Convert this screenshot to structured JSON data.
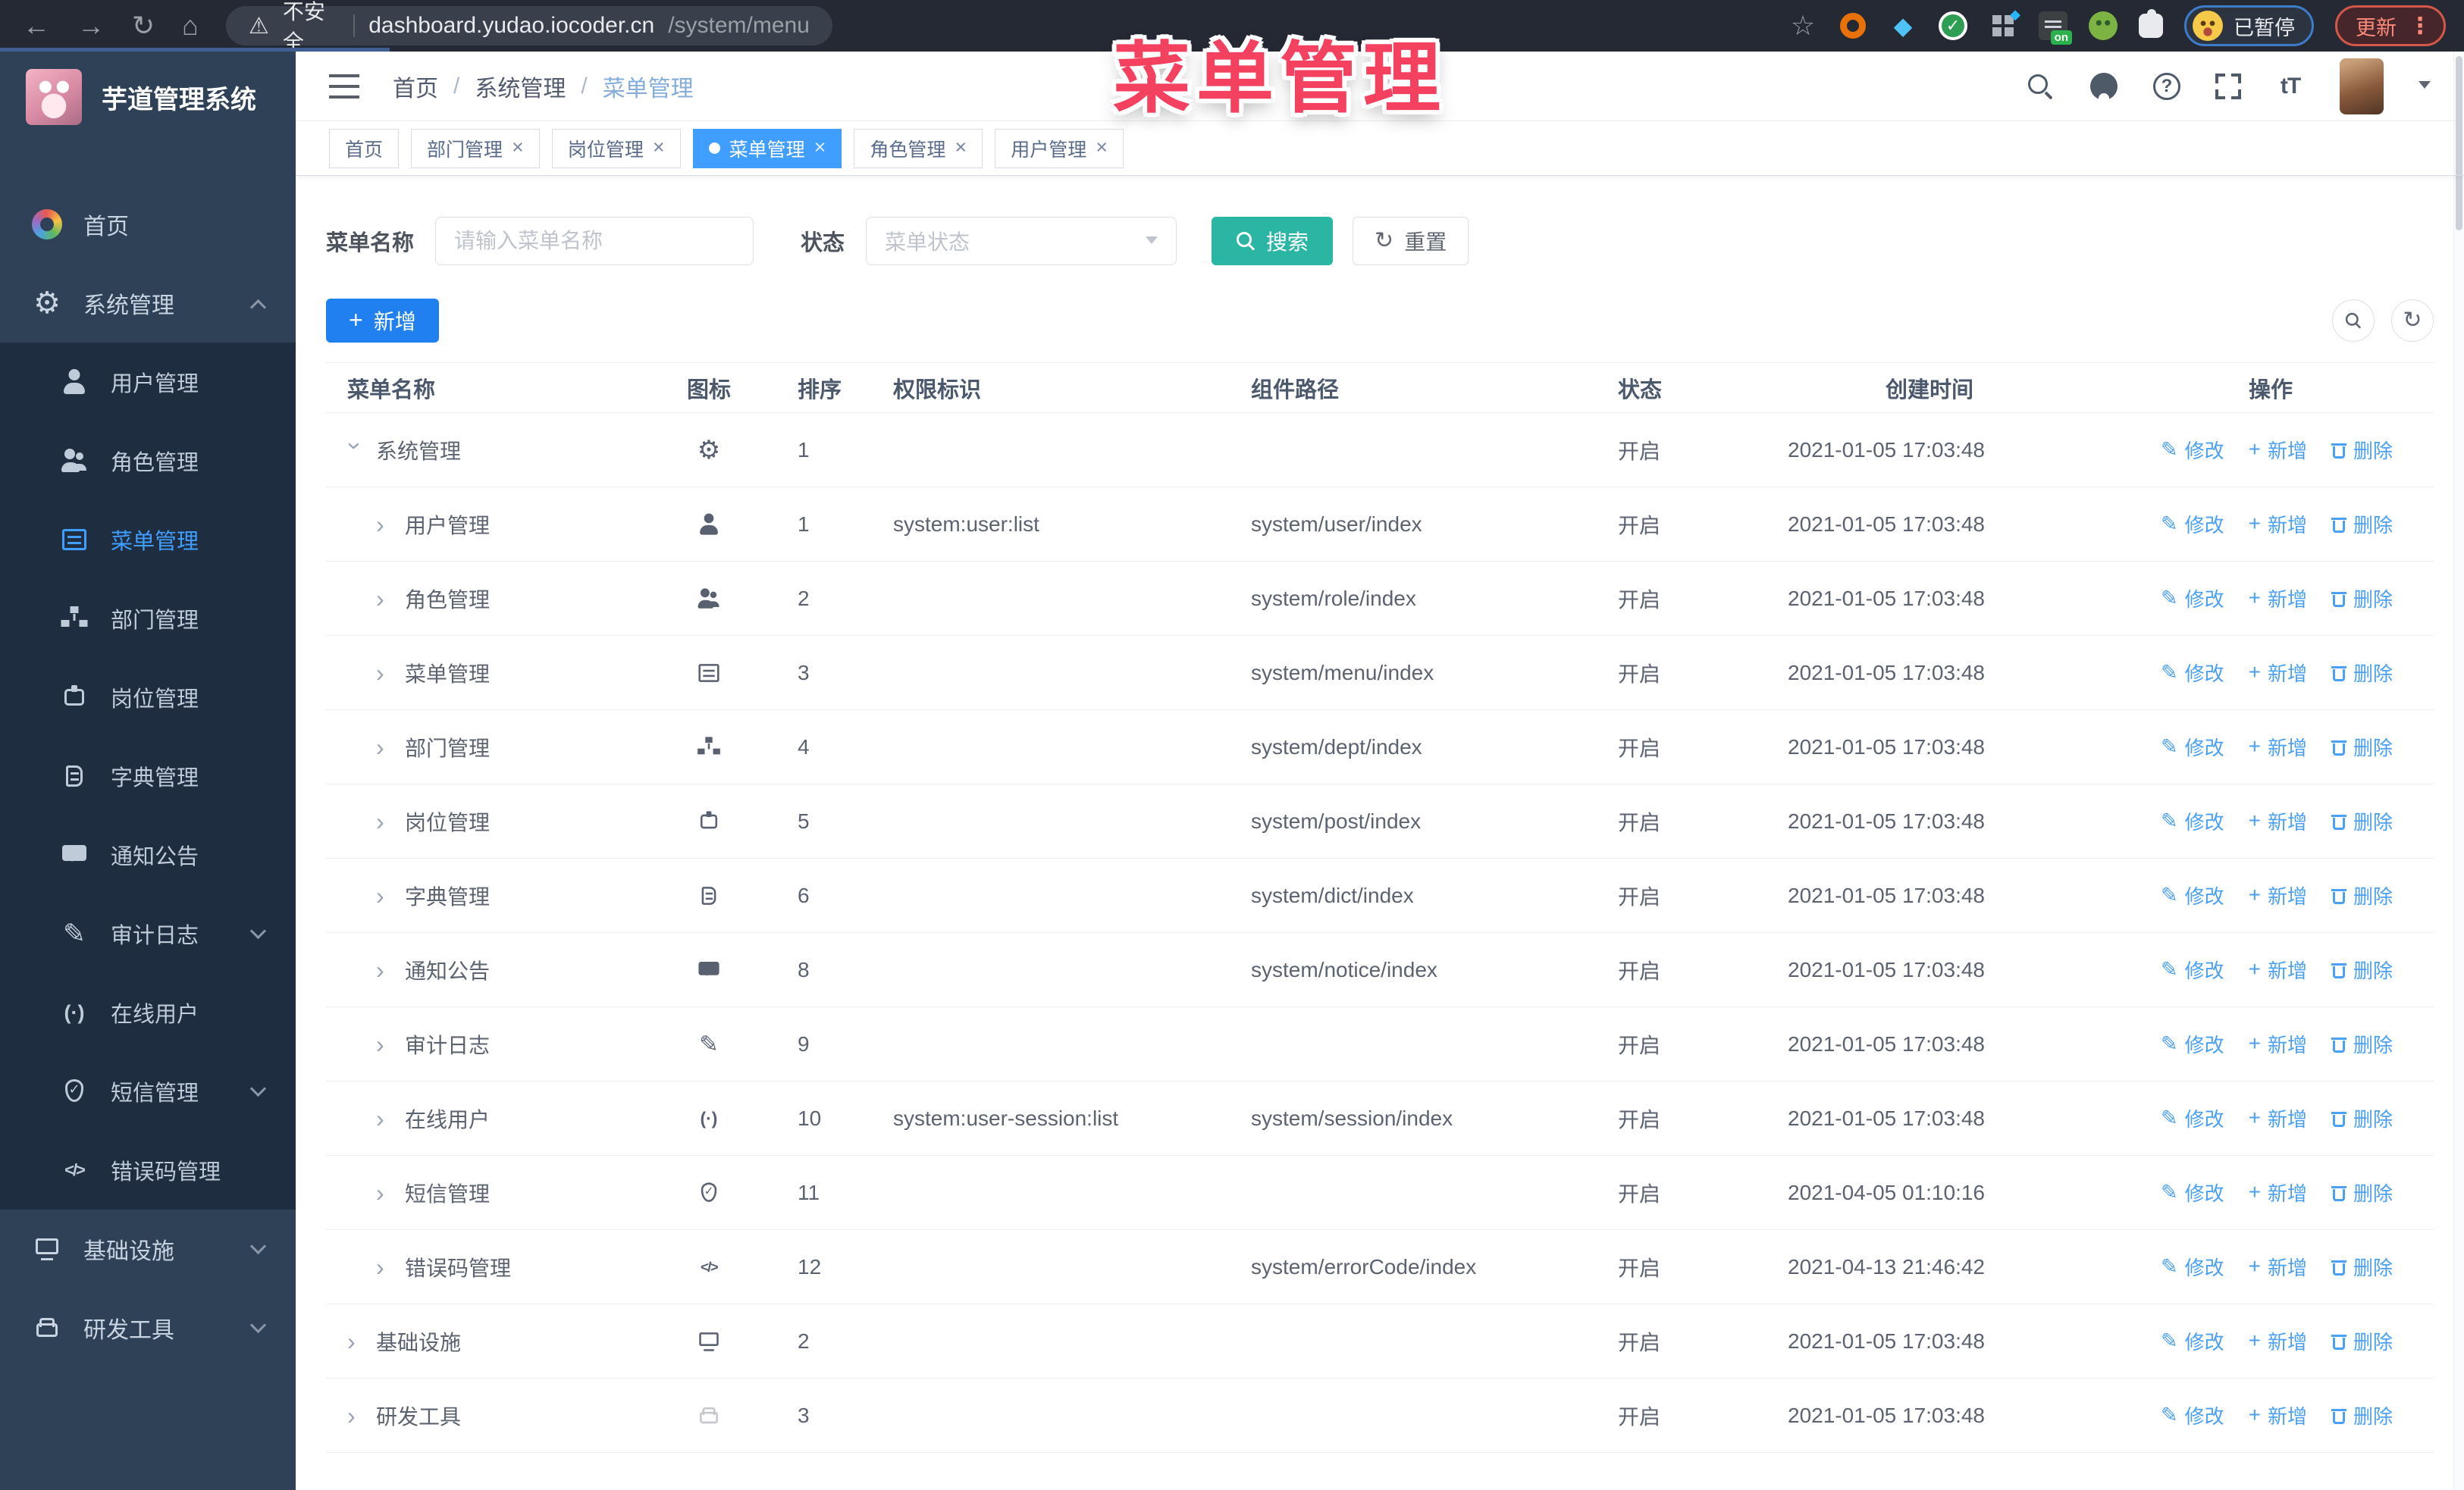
{
  "browser": {
    "security_label": "不安全",
    "url_host": "dashboard.yudao.iocoder.cn",
    "url_path": "/system/menu",
    "paused_badge": "已暂停",
    "update_button": "更新"
  },
  "overlay": {
    "title": "菜单管理"
  },
  "sidebar": {
    "logo_title": "芋道管理系统",
    "items": [
      {
        "label": "首页",
        "icon": "home-icon"
      },
      {
        "label": "系统管理",
        "icon": "gear-icon",
        "has_arrow": true,
        "arrow_up": true
      },
      {
        "label": "用户管理",
        "icon": "user-icon",
        "sub": true
      },
      {
        "label": "角色管理",
        "icon": "users-icon",
        "sub": true
      },
      {
        "label": "菜单管理",
        "icon": "menu-icon",
        "sub": true,
        "active": true
      },
      {
        "label": "部门管理",
        "icon": "dept-icon",
        "sub": true
      },
      {
        "label": "岗位管理",
        "icon": "post-icon",
        "sub": true
      },
      {
        "label": "字典管理",
        "icon": "dict-icon",
        "sub": true
      },
      {
        "label": "通知公告",
        "icon": "notice-icon",
        "sub": true
      },
      {
        "label": "审计日志",
        "icon": "audit-icon",
        "sub": true,
        "has_arrow": true
      },
      {
        "label": "在线用户",
        "icon": "online-icon",
        "sub": true
      },
      {
        "label": "短信管理",
        "icon": "sms-icon",
        "sub": true,
        "has_arrow": true
      },
      {
        "label": "错误码管理",
        "icon": "errcode-icon",
        "sub": true
      },
      {
        "label": "基础设施",
        "icon": "infra-icon",
        "has_arrow": true
      },
      {
        "label": "研发工具",
        "icon": "tools-icon",
        "has_arrow": true
      }
    ]
  },
  "header": {
    "breadcrumb": [
      "首页",
      "系统管理",
      "菜单管理"
    ],
    "separator": "/"
  },
  "tags": [
    {
      "label": "首页"
    },
    {
      "label": "部门管理",
      "closable": true
    },
    {
      "label": "岗位管理",
      "closable": true
    },
    {
      "label": "菜单管理",
      "closable": true,
      "active": true
    },
    {
      "label": "角色管理",
      "closable": true
    },
    {
      "label": "用户管理",
      "closable": true
    }
  ],
  "filters": {
    "name_label": "菜单名称",
    "name_placeholder": "请输入菜单名称",
    "status_label": "状态",
    "status_placeholder": "菜单状态",
    "search_button": "搜索",
    "reset_button": "重置"
  },
  "toolbar": {
    "add_button": "新增"
  },
  "table": {
    "columns": [
      "菜单名称",
      "图标",
      "排序",
      "权限标识",
      "组件路径",
      "状态",
      "创建时间",
      "操作"
    ],
    "actions": {
      "edit": "修改",
      "add": "新增",
      "delete": "删除"
    },
    "rows": [
      {
        "name": "系统管理",
        "icon": "gear-icon",
        "expanded": true,
        "sort": 1,
        "perm": "",
        "path": "",
        "status": "开启",
        "time": "2021-01-05 17:03:48"
      },
      {
        "name": "用户管理",
        "icon": "user-icon",
        "child": true,
        "sort": 1,
        "perm": "system:user:list",
        "path": "system/user/index",
        "status": "开启",
        "time": "2021-01-05 17:03:48"
      },
      {
        "name": "角色管理",
        "icon": "users-icon",
        "child": true,
        "sort": 2,
        "perm": "",
        "path": "system/role/index",
        "status": "开启",
        "time": "2021-01-05 17:03:48"
      },
      {
        "name": "菜单管理",
        "icon": "menu-icon",
        "child": true,
        "sort": 3,
        "perm": "",
        "path": "system/menu/index",
        "status": "开启",
        "time": "2021-01-05 17:03:48"
      },
      {
        "name": "部门管理",
        "icon": "dept-icon",
        "child": true,
        "sort": 4,
        "perm": "",
        "path": "system/dept/index",
        "status": "开启",
        "time": "2021-01-05 17:03:48"
      },
      {
        "name": "岗位管理",
        "icon": "post-icon",
        "child": true,
        "sort": 5,
        "perm": "",
        "path": "system/post/index",
        "status": "开启",
        "time": "2021-01-05 17:03:48"
      },
      {
        "name": "字典管理",
        "icon": "dict-icon",
        "child": true,
        "sort": 6,
        "perm": "",
        "path": "system/dict/index",
        "status": "开启",
        "time": "2021-01-05 17:03:48"
      },
      {
        "name": "通知公告",
        "icon": "notice-icon",
        "child": true,
        "sort": 8,
        "perm": "",
        "path": "system/notice/index",
        "status": "开启",
        "time": "2021-01-05 17:03:48"
      },
      {
        "name": "审计日志",
        "icon": "audit-icon",
        "child": true,
        "sort": 9,
        "perm": "",
        "path": "",
        "status": "开启",
        "time": "2021-01-05 17:03:48"
      },
      {
        "name": "在线用户",
        "icon": "online-icon",
        "child": true,
        "sort": 10,
        "perm": "system:user-session:list",
        "path": "system/session/index",
        "status": "开启",
        "time": "2021-01-05 17:03:48"
      },
      {
        "name": "短信管理",
        "icon": "sms-icon",
        "child": true,
        "sort": 11,
        "perm": "",
        "path": "",
        "status": "开启",
        "time": "2021-04-05 01:10:16"
      },
      {
        "name": "错误码管理",
        "icon": "errcode-icon",
        "child": true,
        "sort": 12,
        "perm": "",
        "path": "system/errorCode/index",
        "status": "开启",
        "time": "2021-04-13 21:46:42"
      },
      {
        "name": "基础设施",
        "icon": "infra-icon",
        "sort": 2,
        "perm": "",
        "path": "",
        "status": "开启",
        "time": "2021-01-05 17:03:48"
      },
      {
        "name": "研发工具",
        "icon": "tools-icon",
        "icon_faded": true,
        "sort": 3,
        "perm": "",
        "path": "",
        "status": "开启",
        "time": "2021-01-05 17:03:48"
      }
    ]
  },
  "colors": {
    "active_blue": "#409eff",
    "search_teal": "#2bb5a3",
    "add_blue": "#2080f0",
    "link_blue": "#4aa0f5",
    "overlay_pink": "#f4415f",
    "sidebar_bg": "#2f4156",
    "submenu_bg": "#1f2d40"
  }
}
